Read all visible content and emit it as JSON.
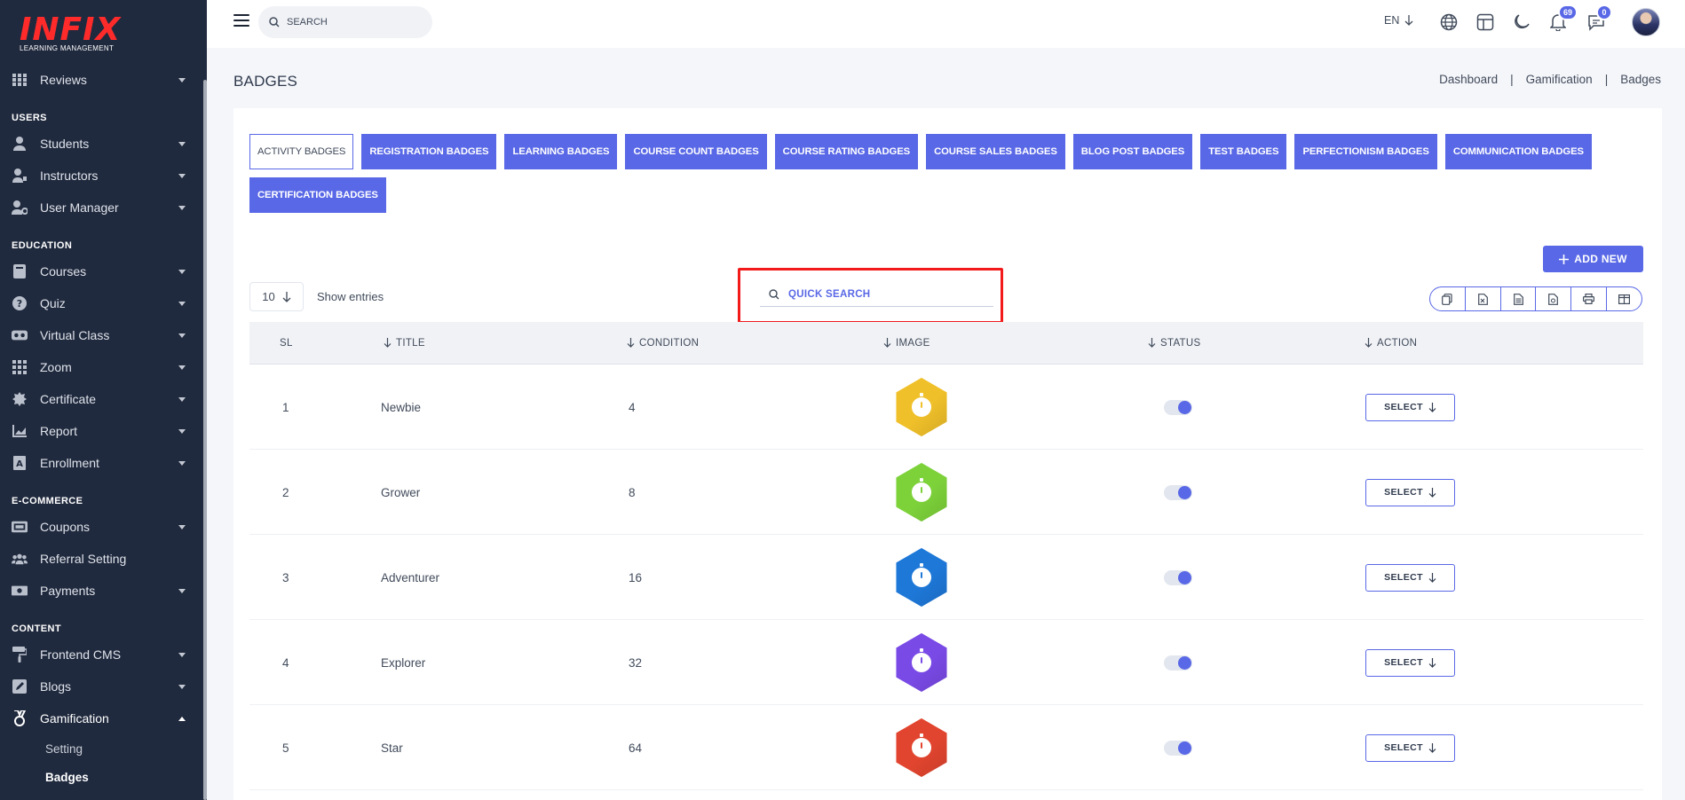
{
  "sidebar": {
    "logo_text": "INFIX",
    "logo_sub": "LEARNING MANAGEMENT",
    "items_top": [
      {
        "label": "Reviews",
        "icon": "grid-icon"
      }
    ],
    "sections": [
      {
        "title": "USERS",
        "items": [
          {
            "label": "Students",
            "icon": "user-icon"
          },
          {
            "label": "Instructors",
            "icon": "instructor-icon"
          },
          {
            "label": "User Manager",
            "icon": "user-gear-icon"
          }
        ]
      },
      {
        "title": "EDUCATION",
        "items": [
          {
            "label": "Courses",
            "icon": "book-icon"
          },
          {
            "label": "Quiz",
            "icon": "question-icon"
          },
          {
            "label": "Virtual Class",
            "icon": "vr-icon"
          },
          {
            "label": "Zoom",
            "icon": "grid-icon"
          },
          {
            "label": "Certificate",
            "icon": "certificate-icon"
          },
          {
            "label": "Report",
            "icon": "chart-icon"
          },
          {
            "label": "Enrollment",
            "icon": "enrollment-icon"
          }
        ]
      },
      {
        "title": "E-COMMERCE",
        "items": [
          {
            "label": "Coupons",
            "icon": "coupon-icon"
          },
          {
            "label": "Referral Setting",
            "icon": "users-icon"
          },
          {
            "label": "Payments",
            "icon": "money-icon"
          }
        ]
      },
      {
        "title": "CONTENT",
        "items": [
          {
            "label": "Frontend CMS",
            "icon": "paint-roller-icon"
          },
          {
            "label": "Blogs",
            "icon": "edit-icon"
          },
          {
            "label": "Gamification",
            "icon": "medal-icon"
          }
        ]
      }
    ],
    "sub_items": [
      {
        "label": "Setting"
      },
      {
        "label": "Badges"
      }
    ]
  },
  "topbar": {
    "search_placeholder": "SEARCH",
    "lang": "EN",
    "notifications_count": "69",
    "messages_count": "0"
  },
  "page": {
    "title": "BADGES",
    "breadcrumb": [
      "Dashboard",
      "Gamification",
      "Badges"
    ]
  },
  "tabs": [
    "ACTIVITY BADGES",
    "REGISTRATION BADGES",
    "LEARNING BADGES",
    "COURSE COUNT BADGES",
    "COURSE RATING BADGES",
    "COURSE SALES BADGES",
    "BLOG POST BADGES",
    "TEST BADGES",
    "PERFECTIONISM BADGES",
    "COMMUNICATION BADGES",
    "CERTIFICATION BADGES"
  ],
  "toolbar": {
    "add_new": "ADD NEW",
    "entries_value": "10",
    "entries_label": "Show entries",
    "quick_search_placeholder": "QUICK SEARCH"
  },
  "table": {
    "headers": [
      "SL",
      "TITLE",
      "CONDITION",
      "IMAGE",
      "STATUS",
      "ACTION"
    ],
    "rows": [
      {
        "sl": "1",
        "title": "Newbie",
        "condition": "4",
        "color": "#f0c02a",
        "action": "SELECT"
      },
      {
        "sl": "2",
        "title": "Grower",
        "condition": "8",
        "color": "#7dd23a",
        "action": "SELECT"
      },
      {
        "sl": "3",
        "title": "Adventurer",
        "condition": "16",
        "color": "#1e78d8",
        "action": "SELECT"
      },
      {
        "sl": "4",
        "title": "Explorer",
        "condition": "32",
        "color": "#7a4ae6",
        "action": "SELECT"
      },
      {
        "sl": "5",
        "title": "Star",
        "condition": "64",
        "color": "#e2452f",
        "action": "SELECT"
      }
    ]
  },
  "colors": {
    "accent": "#5968e6",
    "sidebar_bg": "#202a3e",
    "highlight": "#f21a1a"
  }
}
